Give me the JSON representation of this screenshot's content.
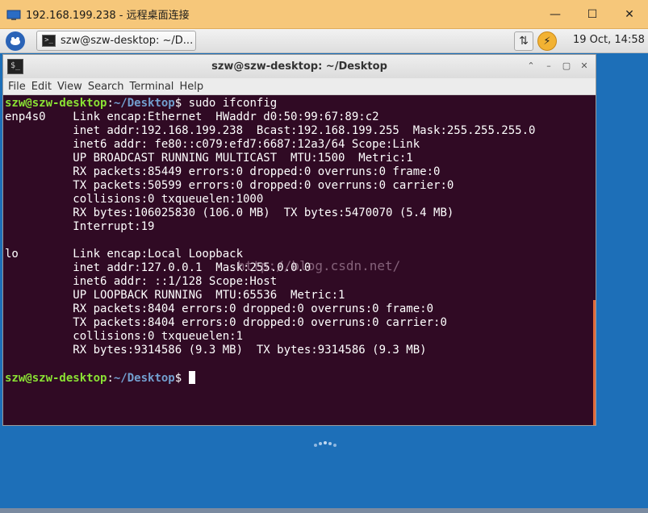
{
  "rdp": {
    "title": "192.168.199.238 - 远程桌面连接",
    "controls": {
      "minimize": "—",
      "maximize": "☐",
      "close": "✕"
    }
  },
  "panel": {
    "task_label": "szw@szw-desktop: ~/D...",
    "clock": "19 Oct, 14:58",
    "net_glyph": "⇅",
    "power_glyph": "⚡"
  },
  "terminal": {
    "title": "szw@szw-desktop: ~/Desktop",
    "menu": [
      "File",
      "Edit",
      "View",
      "Search",
      "Terminal",
      "Help"
    ],
    "prompt": {
      "user": "szw@szw-desktop",
      "path": "~/Desktop",
      "symbol": "$"
    },
    "command": " sudo ifconfig",
    "output_lines": [
      "enp4s0    Link encap:Ethernet  HWaddr d0:50:99:67:89:c2  ",
      "          inet addr:192.168.199.238  Bcast:192.168.199.255  Mask:255.255.255.0",
      "          inet6 addr: fe80::c079:efd7:6687:12a3/64 Scope:Link",
      "          UP BROADCAST RUNNING MULTICAST  MTU:1500  Metric:1",
      "          RX packets:85449 errors:0 dropped:0 overruns:0 frame:0",
      "          TX packets:50599 errors:0 dropped:0 overruns:0 carrier:0",
      "          collisions:0 txqueuelen:1000 ",
      "          RX bytes:106025830 (106.0 MB)  TX bytes:5470070 (5.4 MB)",
      "          Interrupt:19 ",
      "",
      "lo        Link encap:Local Loopback  ",
      "          inet addr:127.0.0.1  Mask:255.0.0.0",
      "          inet6 addr: ::1/128 Scope:Host",
      "          UP LOOPBACK RUNNING  MTU:65536  Metric:1",
      "          RX packets:8404 errors:0 dropped:0 overruns:0 frame:0",
      "          TX packets:8404 errors:0 dropped:0 overruns:0 carrier:0",
      "          collisions:0 txqueuelen:1 ",
      "          RX bytes:9314586 (9.3 MB)  TX bytes:9314586 (9.3 MB)",
      ""
    ],
    "watermark": "http://blog.csdn.net/"
  },
  "colors": {
    "terminal_bg": "#300a24",
    "prompt_user": "#8ae234",
    "prompt_path": "#729fcf",
    "rdp_titlebar": "#f6c77a",
    "desktop": "#1d6fb8"
  }
}
